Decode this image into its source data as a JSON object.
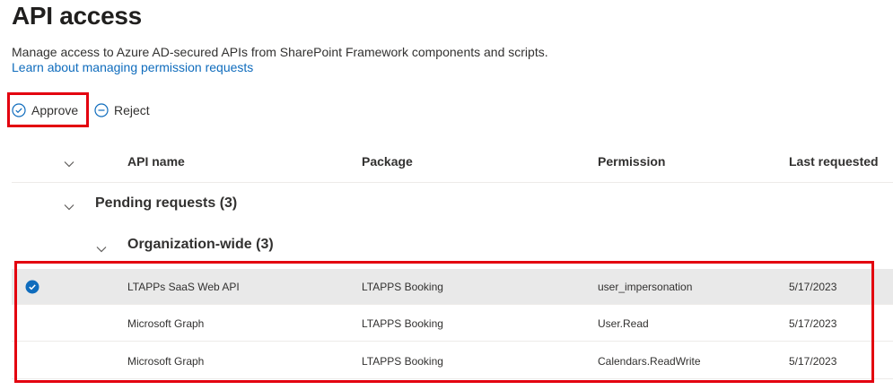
{
  "header": {
    "title": "API access",
    "description": "Manage access to Azure AD-secured APIs from SharePoint Framework components and scripts.",
    "link": "Learn about managing permission requests"
  },
  "commands": {
    "approve": "Approve",
    "reject": "Reject"
  },
  "columns": {
    "api_name": "API name",
    "package": "Package",
    "permission": "Permission",
    "last_requested": "Last requested"
  },
  "groups": {
    "pending": "Pending requests (3)",
    "org_wide": "Organization-wide (3)"
  },
  "rows": [
    {
      "api": "LTAPPs SaaS Web API",
      "package": "LTAPPS Booking",
      "permission": "user_impersonation",
      "date": "5/17/2023",
      "selected": true
    },
    {
      "api": "Microsoft Graph",
      "package": "LTAPPS Booking",
      "permission": "User.Read",
      "date": "5/17/2023",
      "selected": false
    },
    {
      "api": "Microsoft Graph",
      "package": "LTAPPS Booking",
      "permission": "Calendars.ReadWrite",
      "date": "5/17/2023",
      "selected": false
    }
  ],
  "colors": {
    "accent": "#0f6cbd",
    "highlight": "#e3000f",
    "selected_row": "#e9e9e9"
  },
  "icons": {
    "approve": "check-circle-icon",
    "reject": "minus-circle-icon",
    "chevron": "chevron-down-icon",
    "row_check": "checkmark-circle-filled-icon"
  }
}
